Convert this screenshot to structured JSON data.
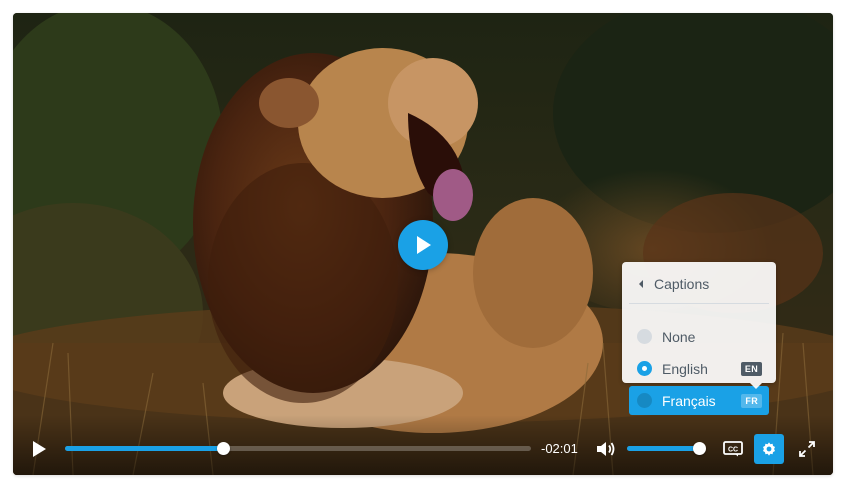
{
  "video": {
    "progress_fraction": 0.34,
    "remaining_time": "-02:01",
    "volume_fraction": 1.0
  },
  "menu": {
    "title": "Captions",
    "options": [
      {
        "label": "None",
        "badge": "",
        "state": "unchecked"
      },
      {
        "label": "English",
        "badge": "EN",
        "state": "checked"
      },
      {
        "label": "Français",
        "badge": "FR",
        "state": "highlighted"
      }
    ]
  },
  "controls": {
    "play_icon": "play-icon",
    "volume_icon": "volume-icon",
    "captions_icon": "cc-icon",
    "settings_icon": "gear-icon",
    "fullscreen_icon": "fullscreen-icon"
  },
  "colors": {
    "accent": "#1aa1e6",
    "menu_text": "#4f5b66"
  }
}
